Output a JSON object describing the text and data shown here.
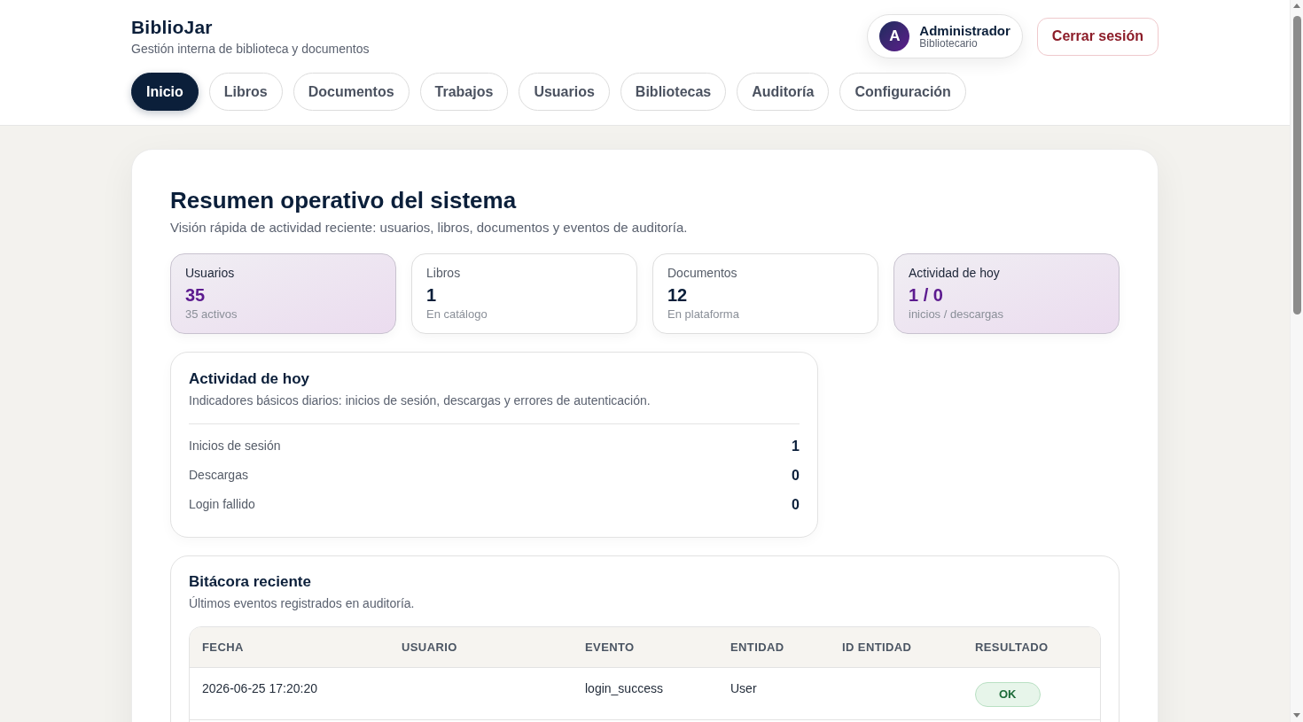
{
  "header": {
    "brand": "BiblioJar",
    "tagline": "Gestión interna de biblioteca y documentos",
    "user": {
      "avatar_letter": "A",
      "name": "Administrador",
      "role": "Bibliotecario"
    },
    "logout_button": "Cerrar sesión"
  },
  "nav_tabs": [
    {
      "label": "Inicio",
      "selected": true
    },
    {
      "label": "Libros",
      "selected": false
    },
    {
      "label": "Documentos",
      "selected": false
    },
    {
      "label": "Trabajos",
      "selected": false
    },
    {
      "label": "Usuarios",
      "selected": false
    },
    {
      "label": "Bibliotecas",
      "selected": false
    },
    {
      "label": "Auditoría",
      "selected": false
    },
    {
      "label": "Configuración",
      "selected": false
    }
  ],
  "overview": {
    "title": "Resumen operativo del sistema",
    "subtitle": "Visión rápida de actividad reciente: usuarios, libros, documentos y eventos de auditoría.",
    "stats": [
      {
        "label": "Usuarios",
        "value": "35",
        "note": "35 activos",
        "highlighted": true
      },
      {
        "label": "Libros",
        "value": "1",
        "note": "En catálogo",
        "highlighted": false
      },
      {
        "label": "Documentos",
        "value": "12",
        "note": "En plataforma",
        "highlighted": false
      },
      {
        "label": "Actividad de hoy",
        "value": "1 / 0",
        "note": "inicios / descargas",
        "highlighted": true
      }
    ],
    "activity": {
      "title": "Actividad de hoy",
      "description": "Indicadores básicos diarios: inicios de sesión, descargas y errores de autenticación.",
      "rows": [
        {
          "label": "Inicios de sesión",
          "value": "1"
        },
        {
          "label": "Descargas",
          "value": "0"
        },
        {
          "label": "Login fallido",
          "value": "0"
        }
      ]
    },
    "recent_log": {
      "title": "Bitácora reciente",
      "description": "Últimos eventos registrados en auditoría.",
      "table": {
        "columns": [
          "FECHA",
          "USUARIO",
          "EVENTO",
          "ENTIDAD",
          "ID ENTIDAD",
          "RESULTADO"
        ],
        "rows": [
          {
            "fecha": "2026-06-25 17:20:20",
            "evento": "login_success",
            "entidad": "User",
            "resultado": {
              "label": "OK",
              "kind": "success"
            }
          }
        ]
      }
    }
  }
}
